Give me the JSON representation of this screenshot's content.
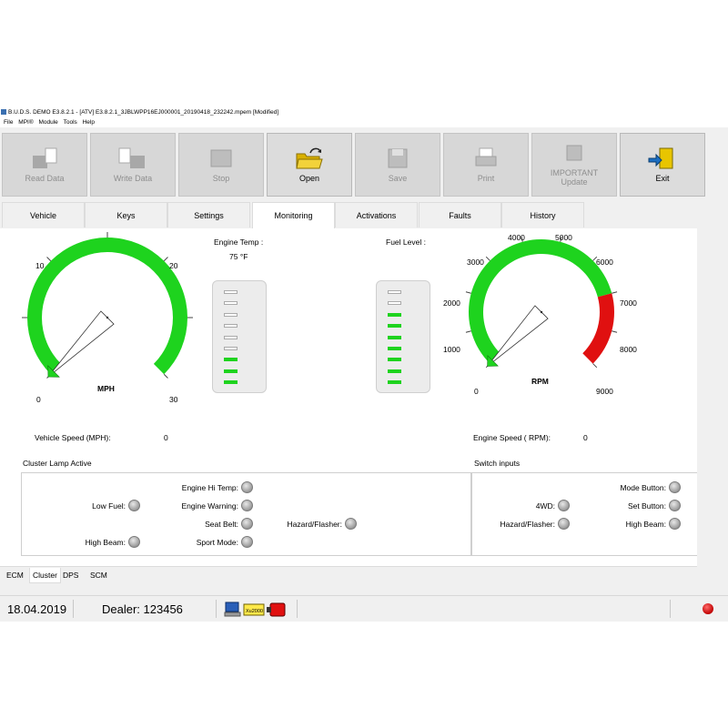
{
  "window": {
    "title": "B.U.D.S. DEMO E3.8.2.1 - [ATV] E3.8.2.1_3JBLWPP16EJ000001_20190418_232242.mpem [Modified]"
  },
  "menu": [
    "File",
    "MPI®",
    "Module",
    "Tools",
    "Help"
  ],
  "toolbar": {
    "read_data": "Read Data",
    "write_data": "Write Data",
    "stop": "Stop",
    "open": "Open",
    "save": "Save",
    "print": "Print",
    "important_update_1": "IMPORTANT",
    "important_update_2": "Update",
    "exit": "Exit"
  },
  "tabs": [
    "Vehicle",
    "Keys",
    "Settings",
    "Monitoring",
    "Activations",
    "Faults",
    "History"
  ],
  "selected_tab": "Monitoring",
  "speed_gauge": {
    "unit_label": "MPH",
    "ticks": [
      "0",
      "10",
      "20",
      "30"
    ],
    "value": 0,
    "max": 30
  },
  "engine_temp": {
    "label": "Engine Temp :",
    "value": "75 °F",
    "segments_total": 9,
    "segments_lit": 3
  },
  "fuel_level": {
    "label": "Fuel Level :",
    "segments_total": 9,
    "segments_lit": 7
  },
  "rpm_gauge": {
    "unit_label": "RPM",
    "ticks": [
      "0",
      "1000",
      "2000",
      "3000",
      "4000",
      "5000",
      "6000",
      "7000",
      "8000",
      "9000"
    ],
    "value": 0,
    "max": 9000,
    "redline": 7000
  },
  "readouts": {
    "vehicle_speed_label": "Vehicle Speed (MPH):",
    "vehicle_speed_value": "0",
    "engine_speed_label": "Engine Speed ( RPM):",
    "engine_speed_value": "0"
  },
  "cluster_lamp": {
    "title": "Cluster Lamp Active",
    "lamps": {
      "engine_hi_temp": "Engine Hi Temp:",
      "engine_warning": "Engine Warning:",
      "low_fuel": "Low Fuel:",
      "seat_belt": "Seat Belt:",
      "hazard_flasher": "Hazard/Flasher:",
      "high_beam": "High Beam:",
      "sport_mode": "Sport Mode:"
    }
  },
  "switch_inputs": {
    "title": "Switch inputs",
    "items": {
      "mode_button": "Mode Button:",
      "four_wd": "4WD:",
      "set_button": "Set Button:",
      "hazard_flasher": "Hazard/Flasher:",
      "high_beam": "High Beam:"
    }
  },
  "subtabs": [
    "ECM",
    "Cluster",
    "DPS",
    "SCM"
  ],
  "selected_subtab": "Cluster",
  "status": {
    "date": "18.04.2019",
    "dealer": "Dealer: 123456",
    "interface_label": "Xu2000"
  },
  "colors": {
    "gauge_green": "#1ed31e",
    "gauge_red": "#e01010",
    "led_red": "#c00000"
  }
}
